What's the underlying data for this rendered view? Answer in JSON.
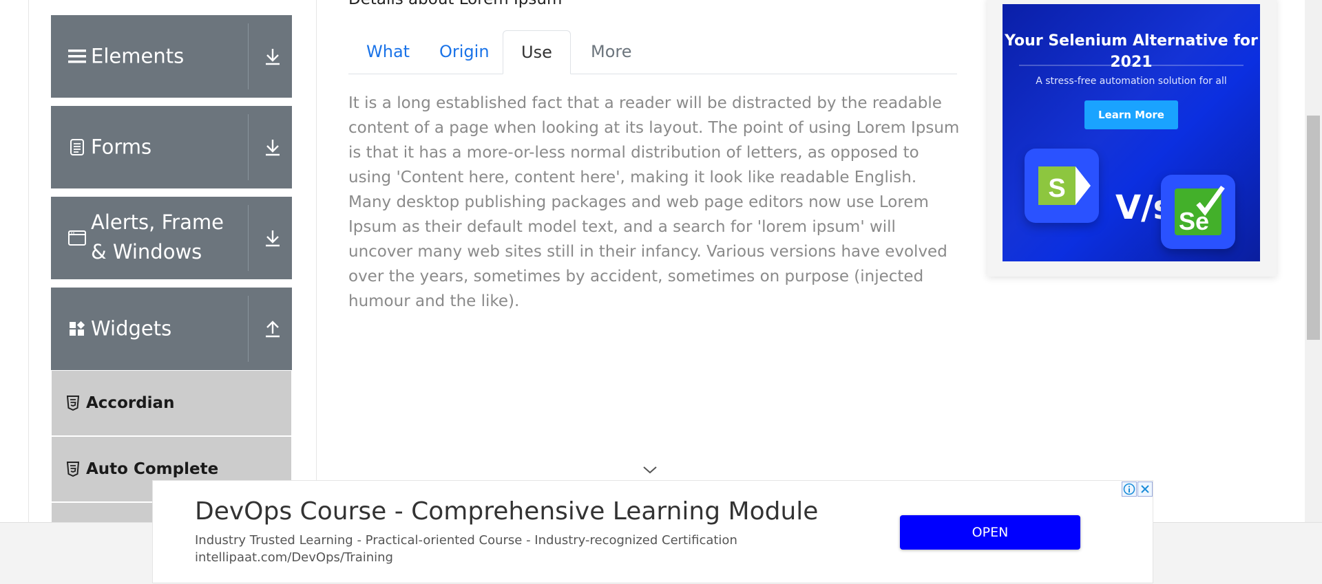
{
  "sidebar": {
    "groups": [
      {
        "label": "Elements",
        "icon": "hamburger-icon",
        "toggle": "download-icon"
      },
      {
        "label": "Forms",
        "icon": "form-document-icon",
        "toggle": "download-icon"
      },
      {
        "label": "Alerts, Frame & Windows",
        "icon": "browser-window-icon",
        "toggle": "download-icon"
      },
      {
        "label": "Widgets",
        "icon": "widgets-icon",
        "toggle": "upload-icon"
      }
    ],
    "items": [
      {
        "label": "Accordian",
        "icon": "html5-icon"
      },
      {
        "label": "Auto Complete",
        "icon": "html5-icon"
      }
    ]
  },
  "main": {
    "heading": "Details about Lorem Ipsum",
    "tabs": [
      {
        "label": "What",
        "state": "link"
      },
      {
        "label": "Origin",
        "state": "link"
      },
      {
        "label": "Use",
        "state": "active"
      },
      {
        "label": "More",
        "state": "disabled"
      }
    ],
    "body": "It is a long established fact that a reader will be distracted by the readable content of a page when looking at its layout. The point of using Lorem Ipsum is that it has a more-or-less normal distribution of letters, as opposed to using 'Content here, content here', making it look like readable English. Many desktop publishing packages and web page editors now use Lorem Ipsum as their default model text, and a search for 'lorem ipsum' will uncover many web sites still in their infancy. Various versions have evolved over the years, sometimes by accident, sometimes on purpose (injected humour and the like)."
  },
  "side_ad": {
    "title": "Your Selenium Alternative for 2021",
    "subtitle": "A stress-free automation solution for all",
    "cta": "Learn More",
    "vs": "V/s",
    "left_logo": "S",
    "right_logo": "Se"
  },
  "bottom_ad": {
    "title": "DevOps Course - Comprehensive Learning Module",
    "description": "Industry Trusted Learning - Practical-oriented Course - Industry-recognized Certification",
    "url": "intellipaat.com/DevOps/Training",
    "button": "OPEN"
  },
  "colors": {
    "sidebar_group": "#6c757d",
    "sidebar_item": "#cccccc",
    "tab_link": "#1a73e8",
    "open_button": "#0000ff",
    "ad_cta": "#1aa3ff"
  }
}
